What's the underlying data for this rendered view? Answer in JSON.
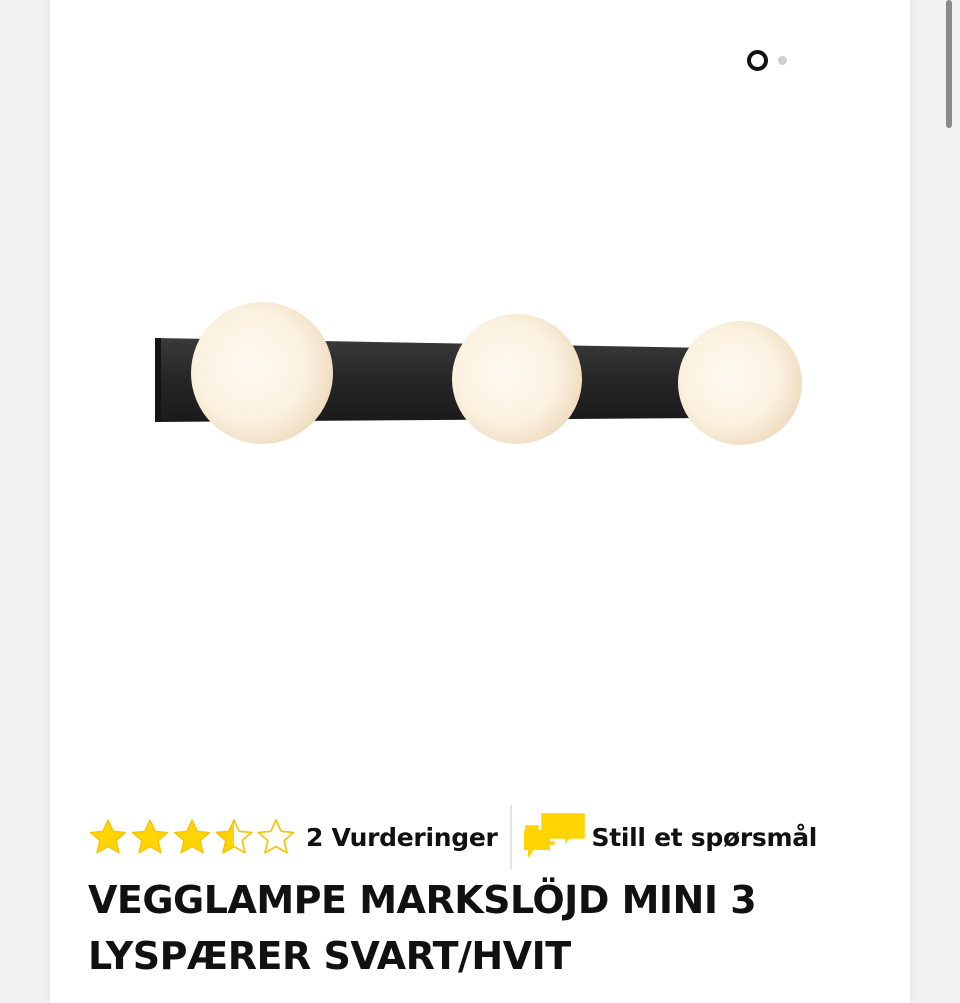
{
  "carousel": {
    "slide_count": 2,
    "active_index": 1
  },
  "product": {
    "image_alt": "Vegglampe Markslöjd Mini 3 lyspærer svart/hvit",
    "title": "VEGGLAMPE MARKSLÖJD MINI 3 LYSPÆRER SVART/HVIT",
    "rating": {
      "value": 3.5,
      "max": 5,
      "count_label": "2 Vurderinger"
    },
    "ask_question_label": "Still et spørsmål"
  },
  "colors": {
    "star_fill": "#ffd400",
    "star_outline": "#f5c400",
    "chat_icon": "#ffd400",
    "text": "#111111",
    "lamp_bar": "#2b2b2b",
    "globe": "#fbf3e4"
  },
  "icons": {
    "rating": "star-icon",
    "ask": "chat-bubbles-icon"
  }
}
